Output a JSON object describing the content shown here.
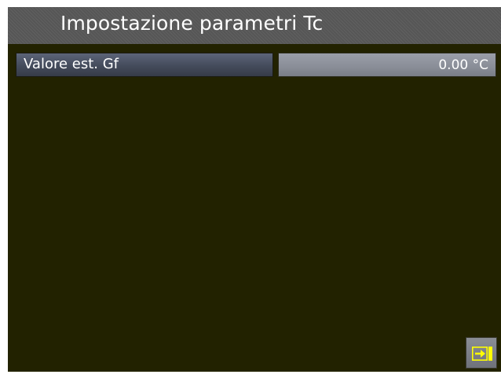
{
  "title": "Impostazione parametri Tc",
  "parameter": {
    "label": "Valore est. Gf",
    "value": "0.00 °C"
  },
  "exit_button": {
    "icon": "exit-arrow-icon",
    "color": "#ffff00"
  },
  "colors": {
    "background": "#222200",
    "title_bar": "#565656",
    "accent": "#ffff00"
  }
}
